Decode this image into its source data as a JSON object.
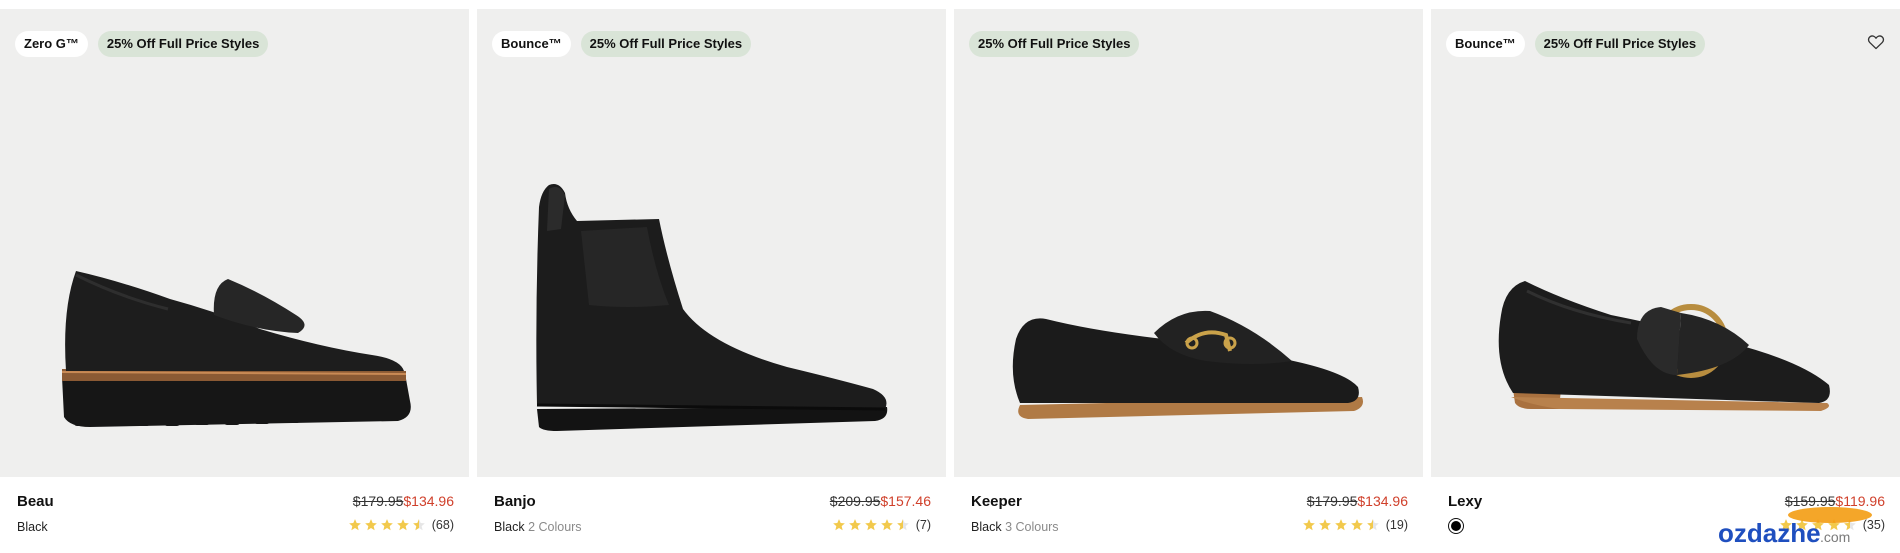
{
  "products": [
    {
      "name": "Beau",
      "tech_badge": "Zero G™",
      "promo_badge": "25% Off Full Price Styles",
      "was_price": "$179.95",
      "now_price": "$134.96",
      "colour": "Black",
      "more_colours": "",
      "rating": 4.5,
      "review_count": "(68)"
    },
    {
      "name": "Banjo",
      "tech_badge": "Bounce™",
      "promo_badge": "25% Off Full Price Styles",
      "was_price": "$209.95",
      "now_price": "$157.46",
      "colour": "Black",
      "more_colours": "2 Colours",
      "rating": 4.5,
      "review_count": "(7)"
    },
    {
      "name": "Keeper",
      "tech_badge": "",
      "promo_badge": "25% Off Full Price Styles",
      "was_price": "$179.95",
      "now_price": "$134.96",
      "colour": "Black",
      "more_colours": "3 Colours",
      "rating": 4.5,
      "review_count": "(19)"
    },
    {
      "name": "Lexy",
      "tech_badge": "Bounce™",
      "promo_badge": "25% Off Full Price Styles",
      "was_price": "$159.95",
      "now_price": "$119.96",
      "colour": "",
      "more_colours": "",
      "rating": 4.5,
      "review_count": "(35)",
      "swatch_color": "#000000"
    }
  ],
  "icons": {
    "wishlist": "heart-outline-icon",
    "rating": "star-icon"
  },
  "colors": {
    "sale_price": "#d0402b",
    "promo_badge_bg": "#d9e4d7",
    "image_bg": "#efefee",
    "star": "#f2c94c"
  },
  "watermark": {
    "text": "ozdazhe.com"
  }
}
